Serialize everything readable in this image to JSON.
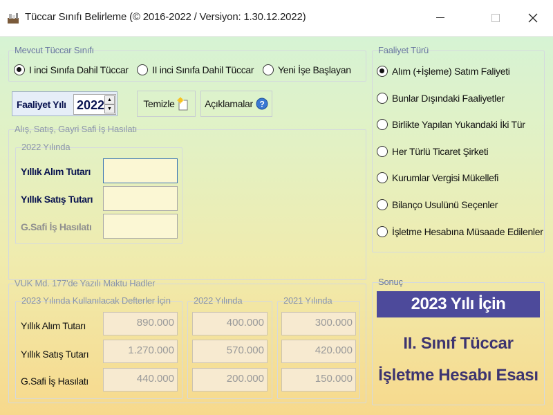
{
  "window": {
    "title": "Tüccar Sınıfı Belirleme (©  2016-2022 / Versiyon: 1.30.12.2022)"
  },
  "mevcut": {
    "label": "Mevcut Tüccar Sınıfı",
    "options": [
      "I inci Sınıfa Dahil Tüccar",
      "II inci Sınıfa Dahil Tüccar",
      "Yeni İşe Başlayan"
    ],
    "selected": 0
  },
  "faaliyet_yili": {
    "label": "Faaliyet Yılı",
    "value": "2022"
  },
  "buttons": {
    "temizle": "Temizle",
    "aciklamalar": "Açıklamalar"
  },
  "hasilat": {
    "label": "Alış, Satış, Gayri Safi İş Hasılatı",
    "sub_label": "2022 Yılında",
    "rows": [
      {
        "label": "Yıllık Alım Tutarı",
        "value": ""
      },
      {
        "label": "Yıllık Satış Tutarı",
        "value": ""
      },
      {
        "label": "G.Safi İş Hasılatı",
        "value": ""
      }
    ]
  },
  "faaliyet_turu": {
    "label": "Faaliyet Türü",
    "options": [
      "Alım (+İşleme) Satım Faliyeti",
      "Bunlar Dışındaki Faaliyetler",
      "Birlikte Yapılan Yukandaki İki Tür",
      "Her Türlü Ticaret Şirketi",
      "Kurumlar Vergisi Mükellefi",
      "Bilanço Usulünü Seçenler",
      "İşletme Hesabına Müsaade Edilenler"
    ],
    "selected": 0
  },
  "vuk": {
    "label": "VUK Md. 177'de Yazılı Maktu Hadler",
    "columns": [
      "2023 Yılında Kullanılacak Defterler İçin",
      "2022 Yılında",
      "2021 Yılında"
    ],
    "row_labels": [
      "Yıllık Alım Tutarı",
      "Yıllık Satış Tutarı",
      "G.Safi İş Hasılatı"
    ],
    "values": [
      [
        "890.000",
        "400.000",
        "300.000"
      ],
      [
        "1.270.000",
        "570.000",
        "420.000"
      ],
      [
        "440.000",
        "200.000",
        "150.000"
      ]
    ]
  },
  "sonuc": {
    "label": "Sonuç",
    "header": "2023 Yılı İçin",
    "line1": "II. Sınıf Tüccar",
    "line2": "İşletme Hesabı Esası"
  },
  "colors": {
    "result_header_bg": "#4d4a9b",
    "result_text": "#3d3470",
    "group_label": "#6a79a0"
  }
}
